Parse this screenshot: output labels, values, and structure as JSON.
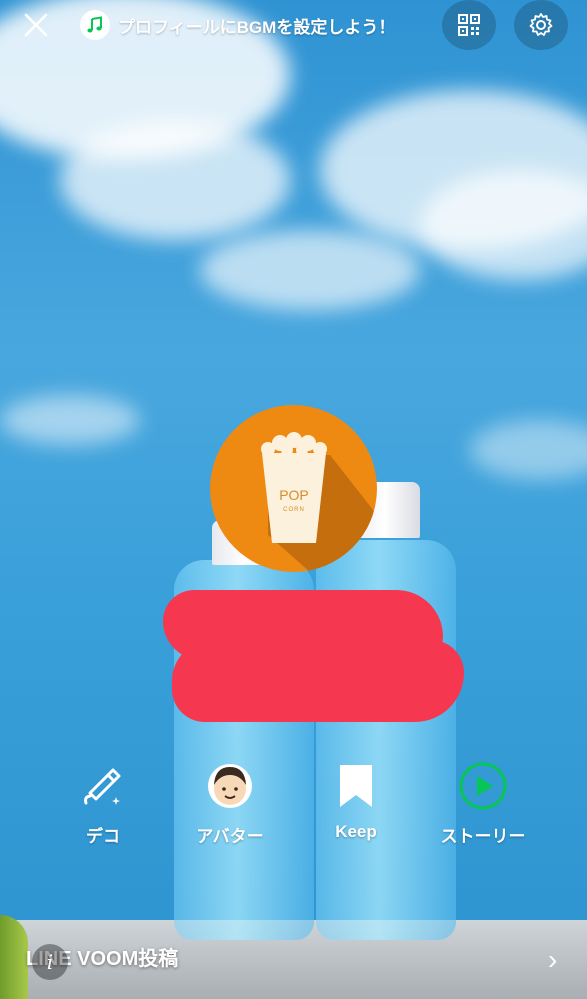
{
  "topbar": {
    "bgm_text": "プロフィールにBGMを設定しよう！",
    "icons": [
      "close-icon",
      "music-note-icon",
      "qr-code-icon",
      "gear-icon"
    ]
  },
  "avatar": {
    "text_line1": "POP",
    "text_line2": "CORN",
    "accent": "#ee8a12"
  },
  "actions": [
    {
      "label": "デコ",
      "icon": "deco-pen-icon"
    },
    {
      "label": "アバター",
      "icon": "avatar-face-icon"
    },
    {
      "label": "Keep",
      "icon": "bookmark-icon"
    },
    {
      "label": "ストーリー",
      "icon": "story-play-icon"
    }
  ],
  "footer": {
    "voom_label": "LINE VOOM投稿",
    "info_glyph": "i",
    "chevron_glyph": "›"
  },
  "colors": {
    "sky": "#3aa0d9",
    "redaction": "#f5374f",
    "line_green": "#06c755"
  }
}
